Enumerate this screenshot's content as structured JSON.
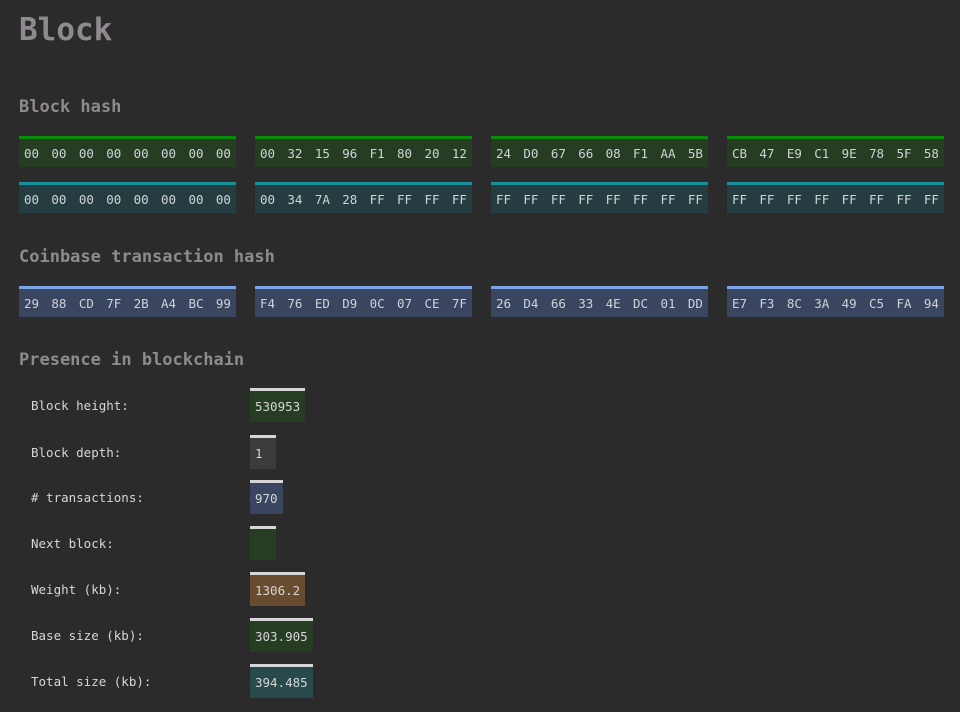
{
  "title": "Block",
  "block_hash": {
    "heading": "Block hash",
    "hash": [
      [
        "00",
        "00",
        "00",
        "00",
        "00",
        "00",
        "00",
        "00"
      ],
      [
        "00",
        "32",
        "15",
        "96",
        "F1",
        "80",
        "20",
        "12"
      ],
      [
        "24",
        "D0",
        "67",
        "66",
        "08",
        "F1",
        "AA",
        "5B"
      ],
      [
        "CB",
        "47",
        "E9",
        "C1",
        "9E",
        "78",
        "5F",
        "58"
      ]
    ],
    "target": [
      [
        "00",
        "00",
        "00",
        "00",
        "00",
        "00",
        "00",
        "00"
      ],
      [
        "00",
        "34",
        "7A",
        "28",
        "FF",
        "FF",
        "FF",
        "FF"
      ],
      [
        "FF",
        "FF",
        "FF",
        "FF",
        "FF",
        "FF",
        "FF",
        "FF"
      ],
      [
        "FF",
        "FF",
        "FF",
        "FF",
        "FF",
        "FF",
        "FF",
        "FF"
      ]
    ]
  },
  "coinbase": {
    "heading": "Coinbase transaction hash",
    "hash": [
      [
        "29",
        "88",
        "CD",
        "7F",
        "2B",
        "A4",
        "BC",
        "99"
      ],
      [
        "F4",
        "76",
        "ED",
        "D9",
        "0C",
        "07",
        "CE",
        "7F"
      ],
      [
        "26",
        "D4",
        "66",
        "33",
        "4E",
        "DC",
        "01",
        "DD"
      ],
      [
        "E7",
        "F3",
        "8C",
        "3A",
        "49",
        "C5",
        "FA",
        "94"
      ]
    ]
  },
  "presence": {
    "heading": "Presence in blockchain",
    "rows": [
      {
        "label": "Block height:",
        "value": "530953",
        "color": "green"
      },
      {
        "label": "Block depth:",
        "value": "1",
        "color": "gray"
      },
      {
        "label": "# transactions:",
        "value": "970",
        "color": "blue"
      },
      {
        "label": "Next block:",
        "value": "",
        "color": "green"
      },
      {
        "label": "Weight (kb):",
        "value": "1306.2",
        "color": "orange"
      },
      {
        "label": "Base size (kb):",
        "value": "303.905",
        "color": "green"
      },
      {
        "label": "Total size (kb):",
        "value": "394.485",
        "color": "cyan"
      }
    ]
  },
  "colors": {
    "green": "#0a8a0a",
    "teal": "#17909c",
    "blue": "#7aa3e8",
    "gray": "#8a8a8a",
    "orange": "#f0951a",
    "cyan": "#3ac6cc",
    "background": "#2b2b2b",
    "heading": "#8f8a8f"
  }
}
